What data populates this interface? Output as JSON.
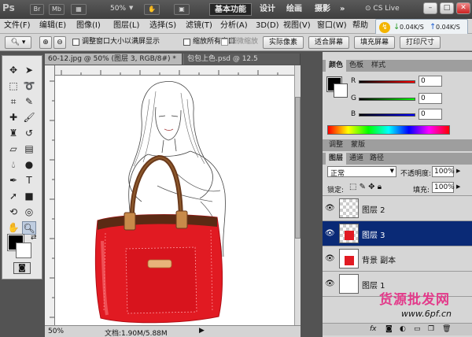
{
  "titlebar": {
    "app_logo": "Ps",
    "br_label": "Br",
    "mb_label": "Mb",
    "zoom": "50%",
    "workspaces": [
      "基本功能",
      "设计",
      "绘画",
      "摄影"
    ],
    "more": "»",
    "cs_live": "CS Live",
    "window_controls": {
      "minimize": "–",
      "restore": "□",
      "close": "✕"
    }
  },
  "menu": {
    "items": [
      "文件(F)",
      "编辑(E)",
      "图像(I)",
      "图层(L)",
      "选择(S)",
      "滤镜(T)",
      "分析(A)",
      "3D(D)",
      "视图(V)",
      "窗口(W)",
      "帮助"
    ]
  },
  "net_widget": {
    "down": "0.04K/S",
    "up": "0.04K/S"
  },
  "options_bar": {
    "chk1": "调整窗口大小以满屏显示",
    "chk2": "缩放所有窗口",
    "chk3": "细微缩放",
    "btn_actual": "实际像素",
    "btn_fit": "适合屏幕",
    "btn_fill": "填充屏幕",
    "btn_print": "打印尺寸"
  },
  "doc_tabs": [
    "60-12.jpg @ 50% (图层 3, RGB/8#) *",
    "包包上色.psd @ 12.5"
  ],
  "status": {
    "zoom": "50%",
    "doc_info": "文档:1.90M/5.88M"
  },
  "color_panel": {
    "tabs": [
      "颜色",
      "色板",
      "样式"
    ],
    "labels": [
      "R",
      "G",
      "B"
    ],
    "values": [
      "0",
      "0",
      "0"
    ]
  },
  "adjust_tabs": [
    "调整",
    "蒙版"
  ],
  "layers_panel": {
    "tabs": [
      "图层",
      "通道",
      "路径"
    ],
    "blend_mode": "正常",
    "opacity_label": "不透明度:",
    "opacity": "100%",
    "lock_label": "锁定:",
    "fill_label": "填充:",
    "fill": "100%",
    "layers": [
      {
        "name": "图层 2",
        "active": false
      },
      {
        "name": "图层 3",
        "active": true
      },
      {
        "name": "背景 副本",
        "active": false
      },
      {
        "name": "图层 1",
        "active": false
      }
    ]
  },
  "watermark": {
    "text1": "货源批发网",
    "text2": "www.6pf.cn"
  },
  "colors": {
    "accent_blue": "#0a2a76",
    "bag_red": "#e11a22",
    "strap_brown": "#6b3a1c"
  }
}
